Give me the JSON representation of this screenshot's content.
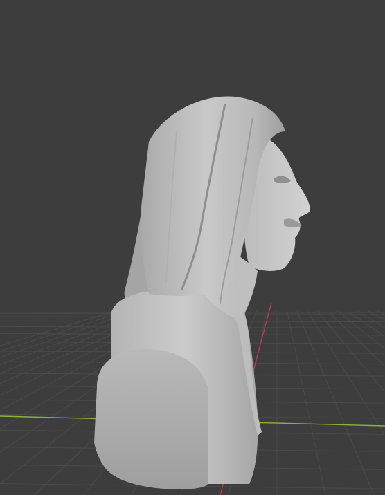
{
  "viewport": {
    "background_color": "#3d3d3d",
    "grid_visible": true,
    "grid_color": "#4a4a4a",
    "x_axis_color": "#8cb33c",
    "y_axis_color": "#c0394a",
    "object_color": "#c8c8c8"
  },
  "scene": {
    "object_type": "sculpted-bust-mesh",
    "shading": "solid"
  }
}
